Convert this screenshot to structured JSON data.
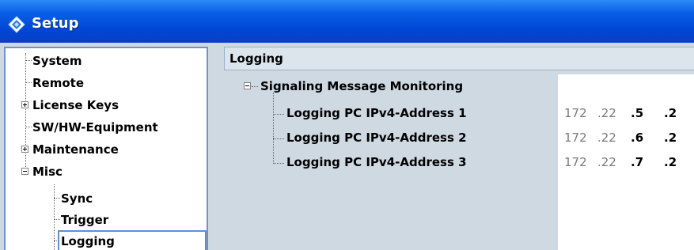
{
  "window": {
    "title": "Setup"
  },
  "icons": {
    "title_icon": "diamond-icon"
  },
  "tree": {
    "items": [
      {
        "label": "System"
      },
      {
        "label": "Remote"
      },
      {
        "label": "License Keys"
      },
      {
        "label": "SW/HW-Equipment"
      },
      {
        "label": "Maintenance"
      },
      {
        "label": "Misc"
      },
      {
        "label": "Sync"
      },
      {
        "label": "Trigger"
      },
      {
        "label": "Logging"
      }
    ],
    "selected": "Logging"
  },
  "panel": {
    "header": "Logging",
    "group_label": "Signaling Message Monitoring",
    "rows": [
      {
        "label": "Logging PC IPv4-Address 1",
        "oct1": "172",
        "oct2": ".22",
        "oct3": ".5",
        "oct4": ".2"
      },
      {
        "label": "Logging PC IPv4-Address 2",
        "oct1": "172",
        "oct2": ".22",
        "oct3": ".6",
        "oct4": ".2"
      },
      {
        "label": "Logging PC IPv4-Address 3",
        "oct1": "172",
        "oct2": ".22",
        "oct3": ".7",
        "oct4": ".2"
      }
    ]
  }
}
